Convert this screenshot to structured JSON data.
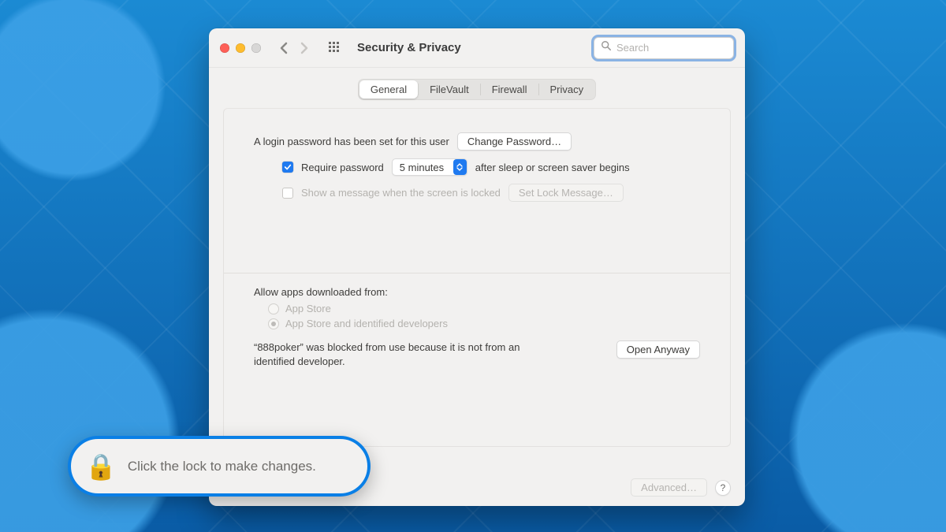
{
  "window": {
    "title": "Security & Privacy"
  },
  "search": {
    "placeholder": "Search"
  },
  "tabs": [
    {
      "label": "General",
      "active": true
    },
    {
      "label": "FileVault",
      "active": false
    },
    {
      "label": "Firewall",
      "active": false
    },
    {
      "label": "Privacy",
      "active": false
    }
  ],
  "general": {
    "login_text": "A login password has been set for this user",
    "change_password_btn": "Change Password…",
    "require_password_label_pre": "Require password",
    "require_password_delay": "5 minutes",
    "require_password_label_post": "after sleep or screen saver begins",
    "show_message_label": "Show a message when the screen is locked",
    "set_lock_message_btn": "Set Lock Message…",
    "allow_header": "Allow apps downloaded from:",
    "radio1": "App Store",
    "radio2": "App Store and identified developers",
    "blocked_app": "“888poker” was blocked from use because it is not from an identified developer.",
    "open_anyway_btn": "Open Anyway"
  },
  "footer": {
    "advanced_btn": "Advanced…",
    "lock_text": "Click the lock to make changes."
  },
  "callout": {
    "text": "Click the lock to make changes."
  }
}
